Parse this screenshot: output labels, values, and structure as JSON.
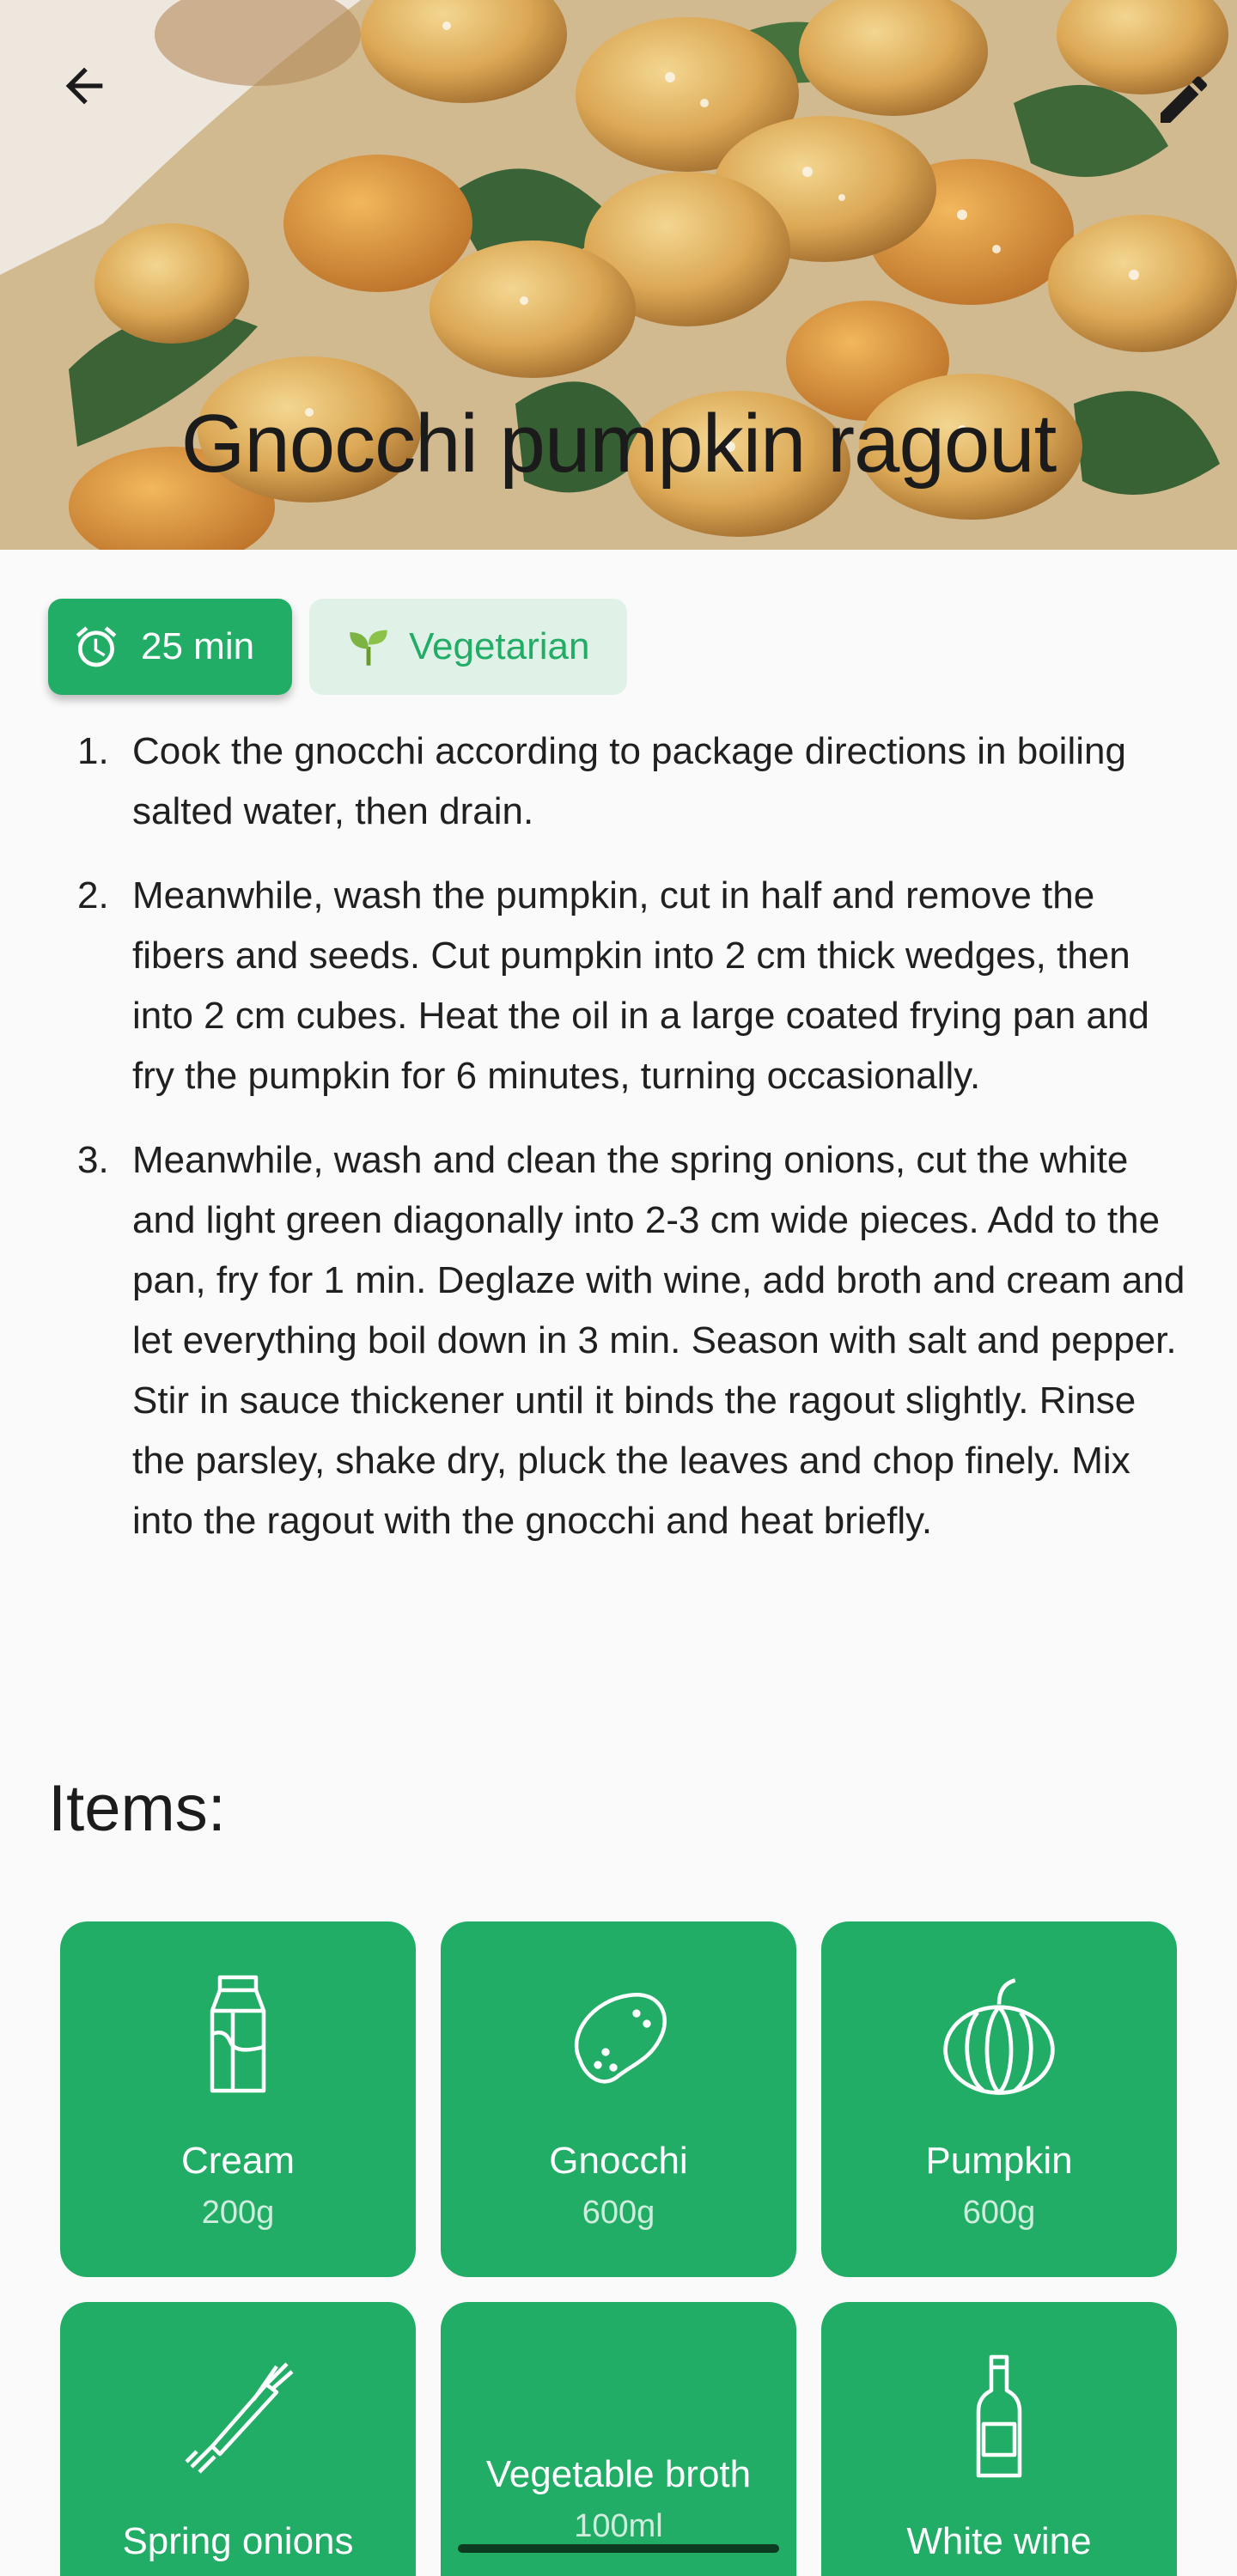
{
  "recipe": {
    "title": "Gnocchi pumpkin ragout",
    "time": "25 min",
    "category": "Vegetarian"
  },
  "icons": {
    "back": "arrow-back-icon",
    "edit": "pencil-icon",
    "time": "alarm-clock-icon",
    "category": "sprout-icon"
  },
  "steps": [
    {
      "number": "1.",
      "text": "Cook the gnocchi according to package directions in boiling salted water, then drain."
    },
    {
      "number": "2.",
      "text": "Meanwhile, wash the pumpkin, cut in half and remove the fibers and seeds. Cut pumpkin into 2 cm thick wedges, then into 2 cm cubes. Heat the oil in a large coated frying pan and fry the pumpkin for 6 minutes, turning occasionally."
    },
    {
      "number": "3.",
      "text": "Meanwhile, wash and clean the spring onions, cut the white and light green diagonally into 2-3 cm wide pieces. Add to the pan, fry for 1 min. Deglaze with wine, add broth and cream and let everything boil down in 3 min. Season with salt and pepper. Stir in sauce thickener until it binds the ragout slightly. Rinse the parsley, shake dry, pluck the leaves and chop finely. Mix into the ragout with the gnocchi and heat briefly."
    }
  ],
  "items_heading": "Items:",
  "items": [
    {
      "name": "Cream",
      "amount": "200g",
      "icon": "milk-carton-icon"
    },
    {
      "name": "Gnocchi",
      "amount": "600g",
      "icon": "potato-icon"
    },
    {
      "name": "Pumpkin",
      "amount": "600g",
      "icon": "pumpkin-icon"
    },
    {
      "name": "Spring onions",
      "amount": "",
      "icon": "spring-onion-icon"
    },
    {
      "name": "Vegetable broth",
      "amount": "100ml",
      "icon": ""
    },
    {
      "name": "White wine",
      "amount": "",
      "icon": "wine-bottle-icon"
    }
  ],
  "colors": {
    "accent": "#22ad66",
    "accent_light": "#e0f2e8",
    "background": "#fafafa"
  }
}
